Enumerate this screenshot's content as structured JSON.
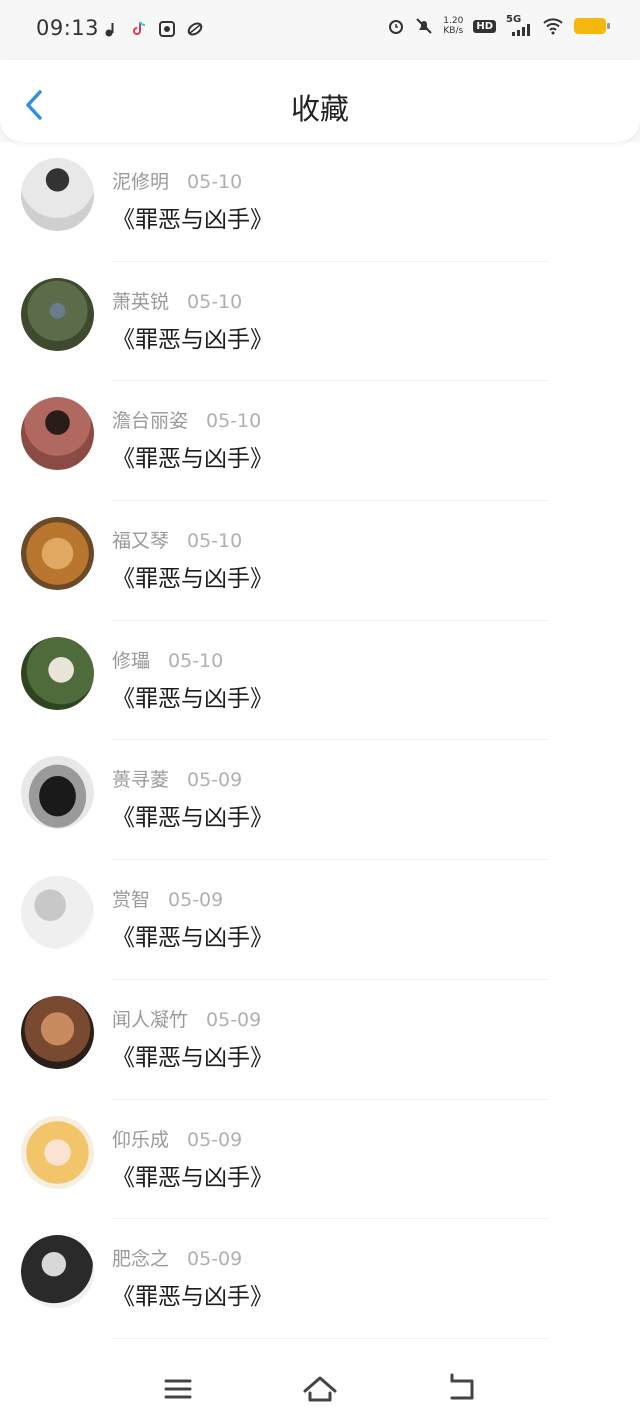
{
  "status_bar": {
    "time": "09:13",
    "speed_value": "1.20",
    "speed_unit": "KB/s",
    "hd": "HD",
    "network": "5G",
    "left_icons": [
      "music-note-icon",
      "tiktok-icon",
      "app-icon",
      "leaf-icon"
    ],
    "right_icons": [
      "alarm-icon",
      "mute-icon",
      "signal-icon",
      "wifi-icon",
      "battery-icon"
    ],
    "battery_color": "#f5b80f"
  },
  "header": {
    "title": "收藏",
    "back_icon": "chevron-left-icon",
    "accent_color": "#2f8fe8"
  },
  "items": [
    {
      "name": "泥修明",
      "date": "05-10",
      "text": "《罪恶与凶手》"
    },
    {
      "name": "萧英锐",
      "date": "05-10",
      "text": "《罪恶与凶手》"
    },
    {
      "name": "澹台丽姿",
      "date": "05-10",
      "text": "《罪恶与凶手》"
    },
    {
      "name": "福又琴",
      "date": "05-10",
      "text": "《罪恶与凶手》"
    },
    {
      "name": "修瓃",
      "date": "05-10",
      "text": "《罪恶与凶手》"
    },
    {
      "name": "蒉寻菱",
      "date": "05-09",
      "text": "《罪恶与凶手》"
    },
    {
      "name": "赏智",
      "date": "05-09",
      "text": "《罪恶与凶手》"
    },
    {
      "name": "闻人凝竹",
      "date": "05-09",
      "text": "《罪恶与凶手》"
    },
    {
      "name": "仰乐成",
      "date": "05-09",
      "text": "《罪恶与凶手》"
    },
    {
      "name": "肥念之",
      "date": "05-09",
      "text": "《罪恶与凶手》"
    }
  ],
  "nav_bar": {
    "icons": [
      "menu-icon",
      "home-icon",
      "back-icon"
    ]
  }
}
